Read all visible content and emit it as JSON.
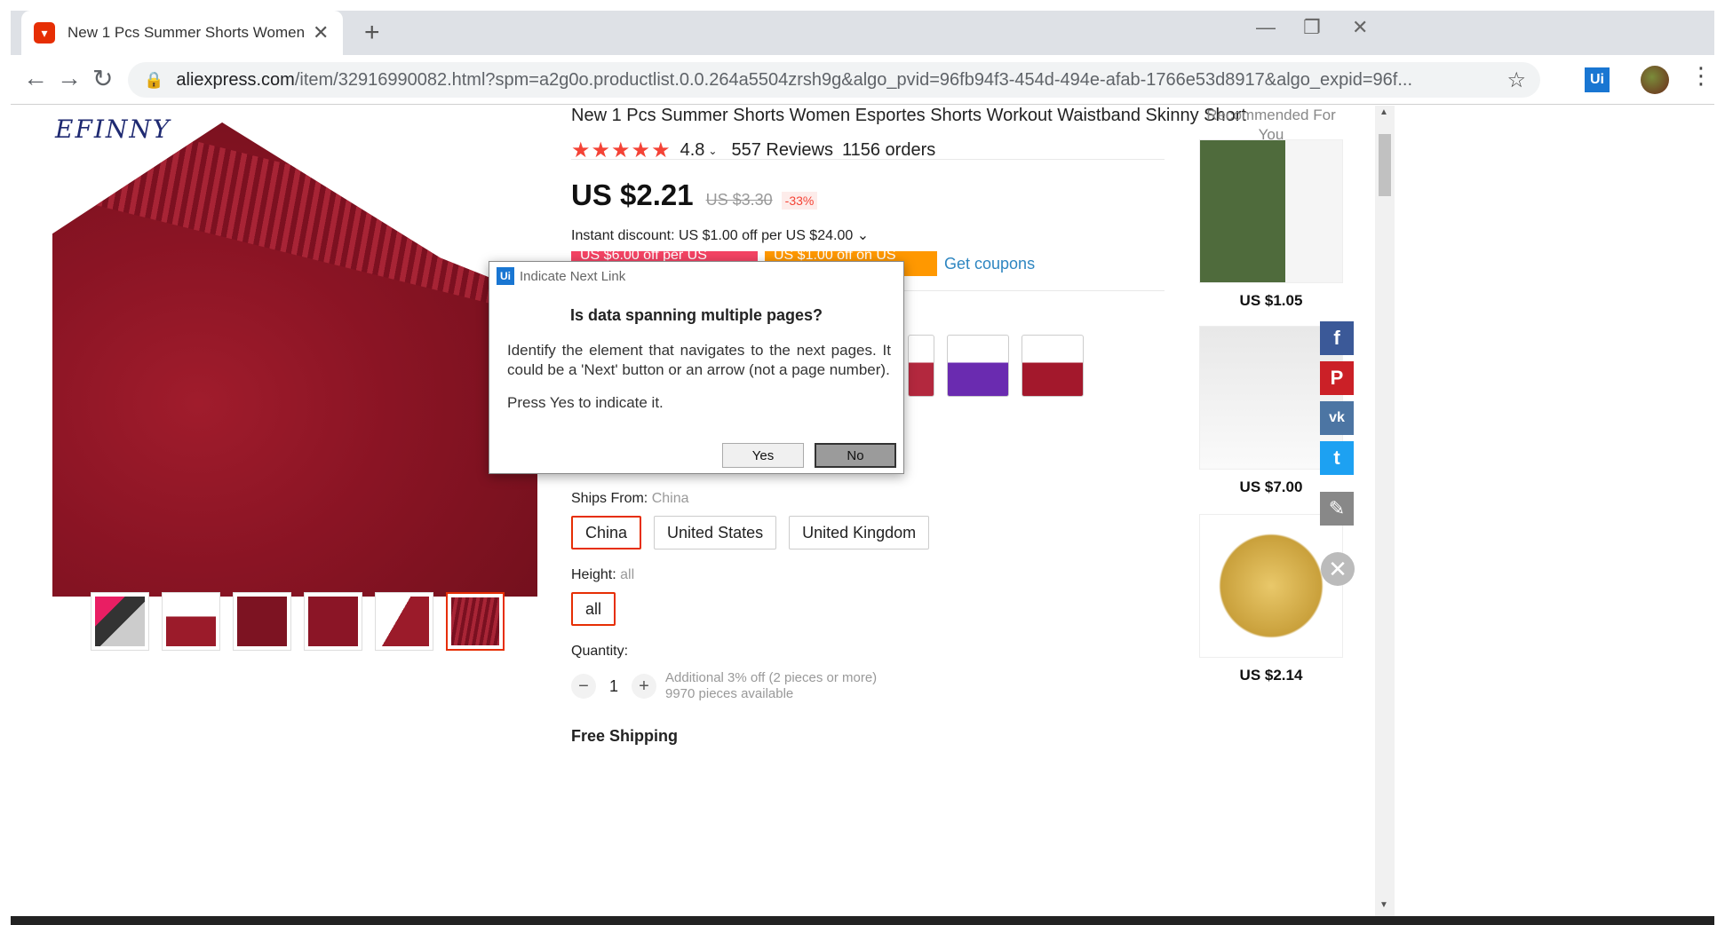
{
  "browser": {
    "tab_title": "New 1 Pcs Summer Shorts Women",
    "url_host": "aliexpress.com",
    "url_rest": "/item/32916990082.html?spm=a2g0o.productlist.0.0.264a5504zrsh9g&algo_pvid=96fb94f3-454d-494e-afab-1766e53d8917&algo_expid=96f...",
    "extension_label": "Ui"
  },
  "brand": {
    "logo_text": "EFINNY"
  },
  "product": {
    "title": "New 1 Pcs Summer Shorts Women Esportes Shorts Workout Waistband Skinny Short",
    "stars": "★★★★★",
    "rating": "4.8",
    "reviews": "557 Reviews",
    "orders": "1156 orders",
    "price": "US $2.21",
    "old_price": "US $3.30",
    "discount": "-33%",
    "instant_discount": "Instant discount: US $1.00 off per US $24.00",
    "coupon_red": "US $6.00 off per US $65.00",
    "coupon_orange": "US $1.00 off on US $16.00",
    "get_coupons": "Get coupons",
    "ships_from_label": "Ships From:",
    "ships_from_value": "China",
    "ship_options": [
      "China",
      "United States",
      "United Kingdom"
    ],
    "height_label": "Height:",
    "height_value": "all",
    "height_option": "all",
    "quantity_label": "Quantity:",
    "quantity_value": "1",
    "qty_info_1": "Additional 3% off (2 pieces or more)",
    "qty_info_2": "9970 pieces available",
    "free_shipping": "Free Shipping"
  },
  "recommended": {
    "title": "Recommended For You",
    "items": [
      {
        "price": "US $1.05"
      },
      {
        "price": "US $7.00"
      },
      {
        "price": "US $2.14"
      }
    ]
  },
  "social": {
    "facebook": "f",
    "pinterest": "P",
    "vk": "vk",
    "twitter": "t",
    "edit": "✎"
  },
  "dialog": {
    "app_title": "Indicate Next Link",
    "question": "Is data spanning multiple pages?",
    "body": "Identify the element that navigates to the next pages. It could be a 'Next' button or an arrow (not a page number).",
    "body2": "Press Yes to indicate it.",
    "yes_label": "Yes",
    "no_label": "No"
  },
  "colors": {
    "accent": "#e62e04",
    "star": "#f44336",
    "link": "#2e86c1"
  }
}
